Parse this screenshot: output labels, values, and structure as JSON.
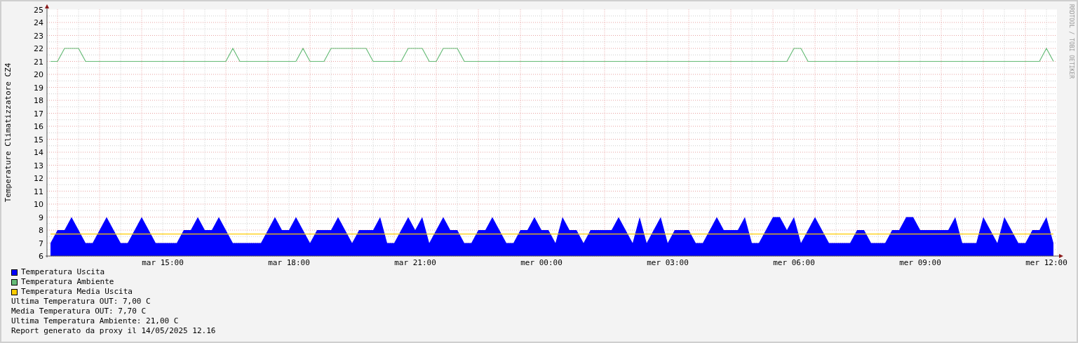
{
  "chart": {
    "credit": "RRDTOOL / TOBI OETIKER",
    "chart_data": {
      "type": "area",
      "ylabel": "Temperature Climatizzatore CZ4",
      "ylim": [
        6,
        25
      ],
      "grid": true,
      "yticks": [
        6,
        7,
        8,
        9,
        10,
        11,
        12,
        13,
        14,
        15,
        16,
        17,
        18,
        19,
        20,
        21,
        22,
        23,
        24,
        25
      ],
      "categories": [
        null,
        null,
        null,
        null,
        null,
        null,
        null,
        null,
        null,
        null,
        null,
        null,
        null,
        null,
        null,
        null,
        "mar 15:00",
        null,
        null,
        null,
        null,
        null,
        null,
        null,
        null,
        null,
        null,
        null,
        null,
        null,
        null,
        null,
        null,
        null,
        "mar 18:00",
        null,
        null,
        null,
        null,
        null,
        null,
        null,
        null,
        null,
        null,
        null,
        null,
        null,
        null,
        null,
        null,
        null,
        "mar 21:00",
        null,
        null,
        null,
        null,
        null,
        null,
        null,
        null,
        null,
        null,
        null,
        null,
        null,
        null,
        null,
        null,
        null,
        "mer 00:00",
        null,
        null,
        null,
        null,
        null,
        null,
        null,
        null,
        null,
        null,
        null,
        null,
        null,
        null,
        null,
        null,
        null,
        "mer 03:00",
        null,
        null,
        null,
        null,
        null,
        null,
        null,
        null,
        null,
        null,
        null,
        null,
        null,
        null,
        null,
        null,
        null,
        "mer 06:00",
        null,
        null,
        null,
        null,
        null,
        null,
        null,
        null,
        null,
        null,
        null,
        null,
        null,
        null,
        null,
        null,
        null,
        "mer 09:00",
        null,
        null,
        null,
        null,
        null,
        null,
        null,
        null,
        null,
        null,
        null,
        null,
        null,
        null,
        null,
        null,
        null,
        "mer 12:00",
        null
      ],
      "series": [
        {
          "name": "Temperatura Uscita",
          "color": "#0000ff",
          "values": [
            7,
            8,
            8,
            9,
            8,
            7,
            7,
            8,
            9,
            8,
            7,
            7,
            8,
            9,
            8,
            7,
            7,
            7,
            7,
            8,
            8,
            9,
            8,
            8,
            9,
            8,
            7,
            7,
            7,
            7,
            7,
            8,
            9,
            8,
            8,
            9,
            8,
            7,
            8,
            8,
            8,
            9,
            8,
            7,
            8,
            8,
            8,
            9,
            7,
            7,
            8,
            9,
            8,
            9,
            7,
            8,
            9,
            8,
            8,
            7,
            7,
            8,
            8,
            9,
            8,
            7,
            7,
            8,
            8,
            9,
            8,
            8,
            7,
            9,
            8,
            8,
            7,
            8,
            8,
            8,
            8,
            9,
            8,
            7,
            9,
            7,
            8,
            9,
            7,
            8,
            8,
            8,
            7,
            7,
            8,
            9,
            8,
            8,
            8,
            9,
            7,
            7,
            8,
            9,
            9,
            8,
            9,
            7,
            8,
            9,
            8,
            7,
            7,
            7,
            7,
            8,
            8,
            7,
            7,
            7,
            8,
            8,
            9,
            9,
            8,
            8,
            8,
            8,
            8,
            9,
            7,
            7,
            7,
            9,
            8,
            7,
            9,
            8,
            7,
            7,
            8,
            8,
            9,
            7
          ]
        },
        {
          "name": "Temperatura Ambiente",
          "color": "#66bb77",
          "type": "line",
          "values": [
            21,
            21,
            22,
            22,
            22,
            21,
            21,
            21,
            21,
            21,
            21,
            21,
            21,
            21,
            21,
            21,
            21,
            21,
            21,
            21,
            21,
            21,
            21,
            21,
            21,
            21,
            22,
            21,
            21,
            21,
            21,
            21,
            21,
            21,
            21,
            21,
            22,
            21,
            21,
            21,
            22,
            22,
            22,
            22,
            22,
            22,
            21,
            21,
            21,
            21,
            21,
            22,
            22,
            22,
            21,
            21,
            22,
            22,
            22,
            21,
            21,
            21,
            21,
            21,
            21,
            21,
            21,
            21,
            21,
            21,
            21,
            21,
            21,
            21,
            21,
            21,
            21,
            21,
            21,
            21,
            21,
            21,
            21,
            21,
            21,
            21,
            21,
            21,
            21,
            21,
            21,
            21,
            21,
            21,
            21,
            21,
            21,
            21,
            21,
            21,
            21,
            21,
            21,
            21,
            21,
            21,
            22,
            22,
            21,
            21,
            21,
            21,
            21,
            21,
            21,
            21,
            21,
            21,
            21,
            21,
            21,
            21,
            21,
            21,
            21,
            21,
            21,
            21,
            21,
            21,
            21,
            21,
            21,
            21,
            21,
            21,
            21,
            21,
            21,
            21,
            21,
            21,
            22,
            21
          ]
        },
        {
          "name": "Temperatura Media Uscita",
          "color": "#ffcc00",
          "type": "line",
          "values": [
            7.7,
            7.7,
            7.7,
            7.7,
            7.7,
            7.7,
            7.7,
            7.7,
            7.7,
            7.7,
            7.7,
            7.7,
            7.7,
            7.7,
            7.7,
            7.7,
            7.7,
            7.7,
            7.7,
            7.7,
            7.7,
            7.7,
            7.7,
            7.7,
            7.7,
            7.7,
            7.7,
            7.7,
            7.7,
            7.7,
            7.7,
            7.7,
            7.7,
            7.7,
            7.7,
            7.7,
            7.7,
            7.7,
            7.7,
            7.7,
            7.7,
            7.7,
            7.7,
            7.7,
            7.7,
            7.7,
            7.7,
            7.7,
            7.7,
            7.7,
            7.7,
            7.7,
            7.7,
            7.7,
            7.7,
            7.7,
            7.7,
            7.7,
            7.7,
            7.7,
            7.7,
            7.7,
            7.7,
            7.7,
            7.7,
            7.7,
            7.7,
            7.7,
            7.7,
            7.7,
            7.7,
            7.7,
            7.7,
            7.7,
            7.7,
            7.7,
            7.7,
            7.7,
            7.7,
            7.7,
            7.7,
            7.7,
            7.7,
            7.7,
            7.7,
            7.7,
            7.7,
            7.7,
            7.7,
            7.7,
            7.7,
            7.7,
            7.7,
            7.7,
            7.7,
            7.7,
            7.7,
            7.7,
            7.7,
            7.7,
            7.7,
            7.7,
            7.7,
            7.7,
            7.7,
            7.7,
            7.7,
            7.7,
            7.7,
            7.7,
            7.7,
            7.7,
            7.7,
            7.7,
            7.7,
            7.7,
            7.7,
            7.7,
            7.7,
            7.7,
            7.7,
            7.7,
            7.7,
            7.7,
            7.7,
            7.7,
            7.7,
            7.7,
            7.7,
            7.7,
            7.7,
            7.7,
            7.7,
            7.7,
            7.7,
            7.7,
            7.7,
            7.7,
            7.7,
            7.7,
            7.7,
            7.7,
            7.7,
            7.7
          ]
        }
      ]
    }
  },
  "summary": [
    "Ultima Temperatura OUT: 7,00 C",
    "Media Temperatura OUT: 7,70 C",
    "Ultima Temperatura Ambiente: 21,00 C",
    "Report generato da proxy il 14/05/2025 12.16"
  ]
}
